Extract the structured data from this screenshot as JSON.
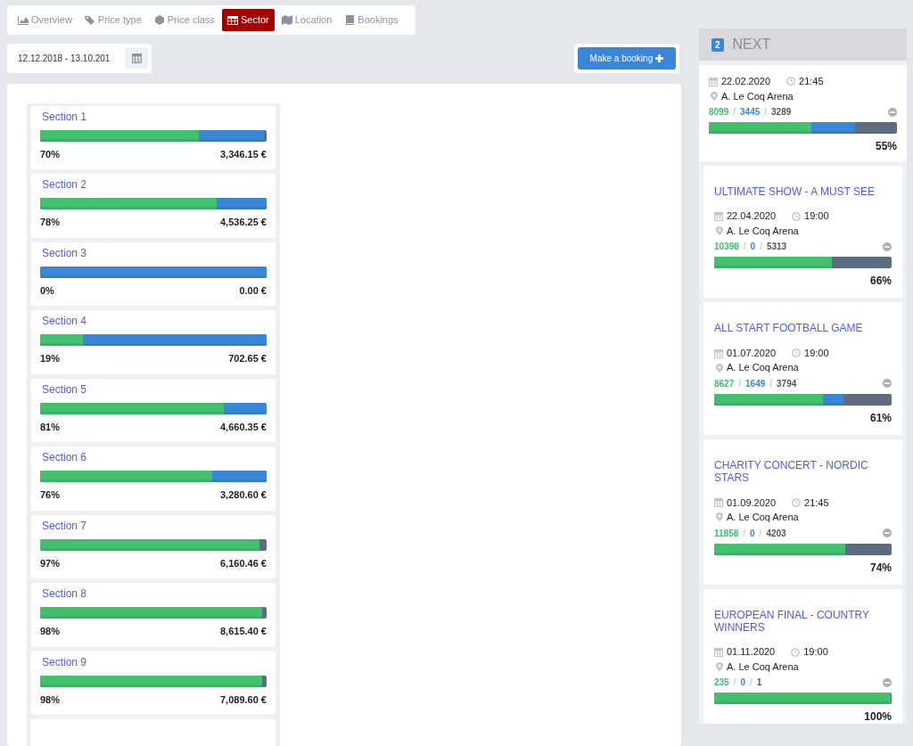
{
  "tabs": [
    {
      "label": "Overview",
      "selected": false
    },
    {
      "label": "Price type",
      "selected": false
    },
    {
      "label": "Price class",
      "selected": false
    },
    {
      "label": "Sector",
      "selected": true
    },
    {
      "label": "Location",
      "selected": false
    },
    {
      "label": "Bookings",
      "selected": false
    }
  ],
  "date_range": {
    "value": "12.12.2018 - 13.10.201"
  },
  "booking_button": {
    "label": "Make a booking"
  },
  "sections": [
    {
      "name": "Section 1",
      "percent": "70%",
      "amount": "3,346.15 €",
      "fills": [
        {
          "kind": "sold_and_reserved",
          "level": 0.99
        },
        {
          "kind": "sold",
          "level": 0.7
        }
      ]
    },
    {
      "name": "Section 2",
      "percent": "78%",
      "amount": "4,536.25 €",
      "fills": [
        {
          "kind": "sold_and_reserved",
          "level": 1
        },
        {
          "kind": "sold",
          "level": 0.78
        }
      ]
    },
    {
      "name": "Section 3",
      "percent": "0%",
      "amount": "0.00 €",
      "fills": [
        {
          "kind": "sold_and_reserved",
          "level": 1
        }
      ]
    },
    {
      "name": "Section 4",
      "percent": "19%",
      "amount": "702.65 €",
      "fills": [
        {
          "kind": "sold_and_reserved",
          "level": 1
        },
        {
          "kind": "sold",
          "level": 0.19
        }
      ]
    },
    {
      "name": "Section 5",
      "percent": "81%",
      "amount": "4,660.35 €",
      "fills": [
        {
          "kind": "sold_and_reserved",
          "level": 1
        },
        {
          "kind": "sold",
          "level": 0.81
        }
      ]
    },
    {
      "name": "Section 6",
      "percent": "76%",
      "amount": "3,280.60 €",
      "fills": [
        {
          "kind": "sold_and_reserved",
          "level": 1
        },
        {
          "kind": "sold",
          "level": 0.76
        }
      ]
    },
    {
      "name": "Section 7",
      "percent": "97%",
      "amount": "6,160.46 €",
      "fills": [
        {
          "kind": "sold",
          "level": 0.97
        }
      ]
    },
    {
      "name": "Section 8",
      "percent": "98%",
      "amount": "8,615.40 €",
      "fills": [
        {
          "kind": "sold",
          "level": 0.98
        }
      ]
    },
    {
      "name": "Section 9",
      "percent": "98%",
      "amount": "7,089.60 €",
      "fills": [
        {
          "kind": "sold",
          "level": 0.98
        }
      ]
    }
  ],
  "next_panel": {
    "count": "2",
    "title": "NEXT",
    "events": [
      {
        "date": "22.02.2020",
        "time": "21:45",
        "venue": "A. Le Coq Arena",
        "counts": [
          "8099",
          "3445",
          "3289"
        ],
        "separators": [
          "/",
          "/"
        ],
        "percent": "55%",
        "fills": [
          {
            "kind": "sold_and_reserved",
            "level": 0.778
          },
          {
            "kind": "sold",
            "level": 0.546
          }
        ]
      },
      {
        "title": "ULTIMATE SHOW - A MUST SEE",
        "date": "22.04.2020",
        "time": "19:00",
        "venue": "A. Le Coq Arena",
        "counts": [
          "10398",
          "0",
          "5313"
        ],
        "separators": [
          "/",
          "/"
        ],
        "percent": "66%",
        "fills": [
          {
            "kind": "sold",
            "level": 0.662
          }
        ]
      },
      {
        "title": "ALL START FOOTBALL GAME",
        "date": "01.07.2020",
        "time": "19:00",
        "venue": "A. Le Coq Arena",
        "counts": [
          "8627",
          "1649",
          "3794"
        ],
        "separators": [
          "/",
          "/"
        ],
        "percent": "61%",
        "fills": [
          {
            "kind": "sold_and_reserved",
            "level": 0.73
          },
          {
            "kind": "sold",
            "level": 0.613
          }
        ]
      },
      {
        "title": "CHARITY CONCERT - NORDIC STARS",
        "date": "01.09.2020",
        "time": "21:45",
        "venue": "A. Le Coq Arena",
        "counts": [
          "11858",
          "0",
          "4203"
        ],
        "separators": [
          "/",
          "/"
        ],
        "percent": "74%",
        "fills": [
          {
            "kind": "sold",
            "level": 0.738
          }
        ]
      },
      {
        "title": "EUROPEAN FINAL - COUNTRY WINNERS",
        "date": "01.11.2020",
        "time": "19:00",
        "venue": "A. Le Coq Arena",
        "counts": [
          "235",
          "0",
          "1"
        ],
        "separators": [
          "/",
          "/"
        ],
        "percent": "100%",
        "fills": [
          {
            "kind": "sold",
            "level": 0.996
          }
        ]
      }
    ]
  }
}
